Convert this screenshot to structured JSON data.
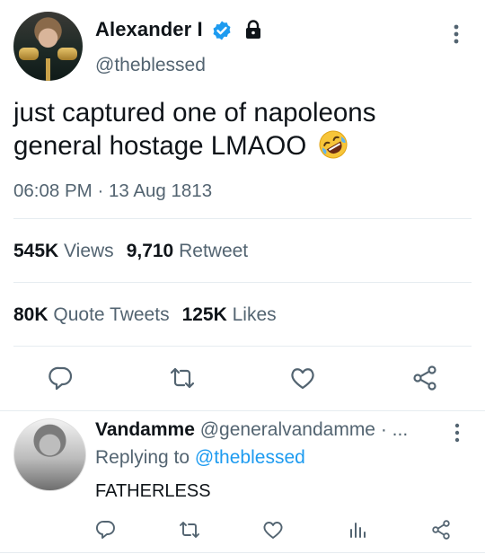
{
  "tweet": {
    "author_name": "Alexander I",
    "handle": "@theblessed",
    "text": "just captured one of napoleons general hostage LMAOO",
    "emoji": "rolling-on-the-floor-laughing",
    "timestamp": "06:08 PM · 13 Aug 1813",
    "stats_row1": {
      "views_count": "545K",
      "views_label": "Views",
      "retweets_count": "9,710",
      "retweets_label": "Retweet"
    },
    "stats_row2": {
      "quotes_count": "80K",
      "quotes_label": "Quote Tweets",
      "likes_count": "125K",
      "likes_label": "Likes"
    },
    "actions": [
      "reply-icon",
      "retweet-icon",
      "like-icon",
      "share-icon"
    ]
  },
  "reply": {
    "author_name": "Vandamme",
    "handle_truncated": "@generalvandamme · ...",
    "replying_prefix": "Replying to",
    "replying_to": "@theblessed",
    "text": "FATHERLESS",
    "actions": [
      "reply-icon",
      "retweet-icon",
      "like-icon",
      "views-icon",
      "share-icon"
    ]
  },
  "colors": {
    "accent": "#1d9bf0",
    "text_primary": "#0f1419",
    "text_secondary": "#536471",
    "divider": "#e6ecf0"
  }
}
